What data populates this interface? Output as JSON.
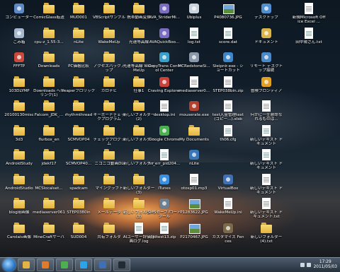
{
  "desktop": {
    "columns": [
      [
        {
          "label": "コンピューター",
          "icon": "app",
          "color": "#5e89c7"
        },
        {
          "label": "ごみ箱",
          "icon": "app",
          "color": "#a6b9cf"
        },
        {
          "label": "FFFTP",
          "icon": "app",
          "color": "#c94a3a"
        },
        {
          "label": "103DLYMP",
          "icon": "folder"
        },
        {
          "label": "20100130misc",
          "icon": "folder"
        },
        {
          "label": "3d3",
          "icon": "folder"
        },
        {
          "label": "AndroidStudy",
          "icon": "folder"
        },
        {
          "label": "AndroidStudio",
          "icon": "folder"
        },
        {
          "label": "blog用画像",
          "icon": "folder"
        },
        {
          "label": "Carolaiv画像",
          "icon": "folder"
        }
      ],
      [
        {
          "label": "ComicGlass転送",
          "icon": "folder"
        },
        {
          "label": "cpu-z_1.55-3...",
          "icon": "folder"
        },
        {
          "label": "Downloads",
          "icon": "folder"
        },
        {
          "label": "Downloads へのリンク(1)",
          "icon": "folder"
        },
        {
          "label": "Falcom_JDK_...",
          "icon": "folder"
        },
        {
          "label": "flurbox_en",
          "icon": "folder"
        },
        {
          "label": "jdekf17",
          "icon": "folder"
        },
        {
          "label": "MCSlocalset...",
          "icon": "folder"
        },
        {
          "label": "mediaserver061",
          "icon": "folder"
        },
        {
          "label": "MineCraftサーバー",
          "icon": "folder"
        }
      ],
      [
        {
          "label": "MUD001",
          "icon": "folder"
        },
        {
          "label": "nLite",
          "icon": "folder"
        },
        {
          "label": "PC価格比較",
          "icon": "folder"
        },
        {
          "label": "reaperフロリック",
          "icon": "folder"
        },
        {
          "label": "rhythmthread",
          "icon": "folder"
        },
        {
          "label": "SCMVOP04",
          "icon": "folder"
        },
        {
          "label": "SCMVOP40...",
          "icon": "folder"
        },
        {
          "label": "spadcam",
          "icon": "folder"
        },
        {
          "label": "STEP0380in",
          "icon": "folder"
        },
        {
          "label": "SUD004",
          "icon": "folder"
        }
      ],
      [
        {
          "label": "VBScriptサンプル",
          "icon": "folder"
        },
        {
          "label": "WakeMeUp",
          "icon": "folder"
        },
        {
          "label": "アクセスバックアップ",
          "icon": "folder"
        },
        {
          "label": "カロナビ",
          "icon": "folder"
        },
        {
          "label": "キーボードチェックプログラム",
          "icon": "folder"
        },
        {
          "label": "チェックプログラム",
          "icon": "folder"
        },
        {
          "label": "ニコニコ動画DL",
          "icon": "folder"
        },
        {
          "label": "マイングラフト",
          "icon": "folder"
        },
        {
          "label": "メールデータ",
          "icon": "folder"
        },
        {
          "label": "共有フォルダ",
          "icon": "folder"
        }
      ],
      [
        {
          "label": "携帯動画変換",
          "icon": "folder"
        },
        {
          "label": "光速等高線",
          "icon": "folder"
        },
        {
          "label": "光速等高線 WakeMeUp",
          "icon": "folder"
        },
        {
          "label": "仕事1",
          "icon": "folder"
        },
        {
          "label": "新しいフォルダー(2)",
          "icon": "folder"
        },
        {
          "label": "新しいフォルダー",
          "icon": "folder"
        },
        {
          "label": "新しいフォルダー",
          "icon": "folder"
        },
        {
          "label": "新しいフォルダー(3)",
          "icon": "folder"
        },
        {
          "label": "新しいフォルダー(3)",
          "icon": "folder"
        },
        {
          "label": "AIユーザー評価録画ログ.log",
          "icon": "file"
        }
      ],
      [
        {
          "label": "AVA_StriderMi...",
          "icon": "app",
          "color": "#7a6cbf"
        },
        {
          "label": "AVAQuickBoo...",
          "icon": "app",
          "color": "#7a6cbf"
        },
        {
          "label": "CopyTrans Control Center",
          "icon": "app",
          "color": "#3aa0c8"
        },
        {
          "label": "Craving Explorer",
          "icon": "app",
          "color": "#c8413a"
        },
        {
          "label": "desktop.ini",
          "icon": "file"
        },
        {
          "label": "Google Chrome",
          "icon": "app",
          "color": "#4caf50"
        },
        {
          "label": "hs_err_pid204...",
          "icon": "file"
        },
        {
          "label": "iTunes",
          "icon": "app",
          "color": "#3b8fe0"
        },
        {
          "label": "SMSセーブ/ロードツール",
          "icon": "app",
          "color": "#6f7f90"
        },
        {
          "label": "jdtest13.zip",
          "icon": "file"
        }
      ],
      [
        {
          "label": "Ubiplus",
          "icon": "app",
          "color": "#c9d4de"
        },
        {
          "label": "log.txt",
          "icon": "file"
        },
        {
          "label": "MCRedstoneSi...",
          "icon": "app",
          "color": "#8a9aab"
        },
        {
          "label": "mediaserver0...",
          "icon": "file"
        },
        {
          "label": "mouserate.exe",
          "icon": "app",
          "color": "#b0412f"
        },
        {
          "label": "My Documents",
          "icon": "folder"
        },
        {
          "label": "nLite",
          "icon": "app",
          "color": "#3976b8"
        },
        {
          "label": "otosp01.mp3",
          "icon": "file"
        },
        {
          "label": "P1283622.JPG",
          "icon": "image"
        },
        {
          "label": "P2170467.JPG",
          "icon": "image"
        }
      ],
      [
        {
          "label": "P4080736.JPG",
          "icon": "image"
        },
        {
          "label": "score.dat",
          "icon": "file"
        },
        {
          "label": "Sleipnir.exe - ショートカット",
          "icon": "app",
          "color": "#3e86c9"
        },
        {
          "label": "STEP038bin.zip",
          "icon": "file"
        },
        {
          "label": "test入金管理text(コピー...).xlsb",
          "icon": "file"
        },
        {
          "label": "th06.cfg",
          "icon": "file"
        },
        {
          "label": "",
          "icon": "none"
        },
        {
          "label": "VirtualBox",
          "icon": "app",
          "color": "#3f6fb5"
        },
        {
          "label": "WakeMeUp.ini",
          "icon": "file"
        },
        {
          "label": "カスタマイズ Fences",
          "icon": "app",
          "color": "#7b6a4a"
        }
      ],
      [
        {
          "label": "デスクトップ",
          "icon": "app",
          "color": "#4f8fd1"
        },
        {
          "label": "ドキュメント",
          "icon": "app",
          "color": "#d9b44a"
        },
        {
          "label": "リモート デスクトップ接続",
          "icon": "app",
          "color": "#4a88c7"
        },
        {
          "label": "冒険フロンティア",
          "icon": "app",
          "color": "#e0a020"
        },
        {
          "label": "何かに一生懸命なれるものは...",
          "icon": "file"
        },
        {
          "label": "新しいテキスト ドキュメント",
          "icon": "file"
        },
        {
          "label": "新しいテキスト ドキュメント",
          "icon": "file"
        },
        {
          "label": "新しいテキスト ドキュメント",
          "icon": "file"
        },
        {
          "label": "新しいテキスト ドキュメント.txt",
          "icon": "file"
        },
        {
          "label": "新しいフォルダー(4).txt",
          "icon": "folder"
        }
      ],
      [
        {
          "label": "新規Microsoft Office Excel ...",
          "icon": "file"
        },
        {
          "label": "田中陽さん.txt",
          "icon": "file"
        },
        {
          "label": "",
          "icon": "none"
        },
        {
          "label": "",
          "icon": "none"
        },
        {
          "label": "",
          "icon": "none"
        },
        {
          "label": "",
          "icon": "none"
        },
        {
          "label": "",
          "icon": "none"
        },
        {
          "label": "",
          "icon": "none"
        },
        {
          "label": "",
          "icon": "none"
        },
        {
          "label": "",
          "icon": "none"
        }
      ]
    ]
  },
  "taskbar": {
    "pinned": [
      {
        "name": "explorer-icon",
        "color": "#e3b443"
      },
      {
        "name": "media-player-icon",
        "color": "#e27a2b"
      },
      {
        "name": "chrome-icon",
        "color": "#4caf50"
      },
      {
        "name": "skype-icon",
        "color": "#2aa3e8"
      },
      {
        "name": "virtualbox-icon",
        "color": "#3f6fb5"
      },
      {
        "name": "console-icon",
        "color": "#222a33"
      }
    ],
    "clock_time": "17:29",
    "clock_date": "2011/05/03"
  }
}
